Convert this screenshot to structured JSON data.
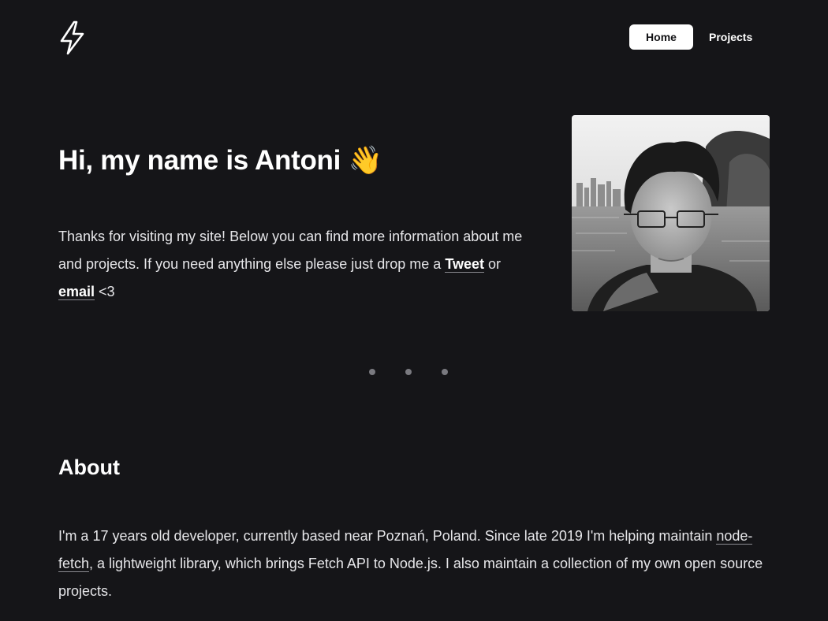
{
  "header": {
    "logo_icon": "lightning-bolt-icon",
    "nav": [
      {
        "label": "Home",
        "active": true
      },
      {
        "label": "Projects",
        "active": false
      }
    ]
  },
  "hero": {
    "title": "Hi, my name is Antoni 👋",
    "text_before": "Thanks for visiting my site! Below you can find more information about me and projects. If you need anything else please just drop me a ",
    "tweet_link": "Tweet",
    "text_middle": " or ",
    "email_link": "email",
    "text_after": " <3",
    "photo_icon": "profile-photo"
  },
  "scroll_indicator": {
    "dots": 3
  },
  "about": {
    "title": "About",
    "text_before": "I'm a 17 years old developer, currently based near Poznań, Poland. Since late 2019 I'm helping maintain ",
    "link": "node-fetch",
    "text_after": ", a lightweight library, which brings Fetch API to Node.js. I also maintain a collection of my own open source projects."
  },
  "colors": {
    "background": "#151518",
    "text": "#e6e6e9",
    "accent": "#ffffff"
  }
}
